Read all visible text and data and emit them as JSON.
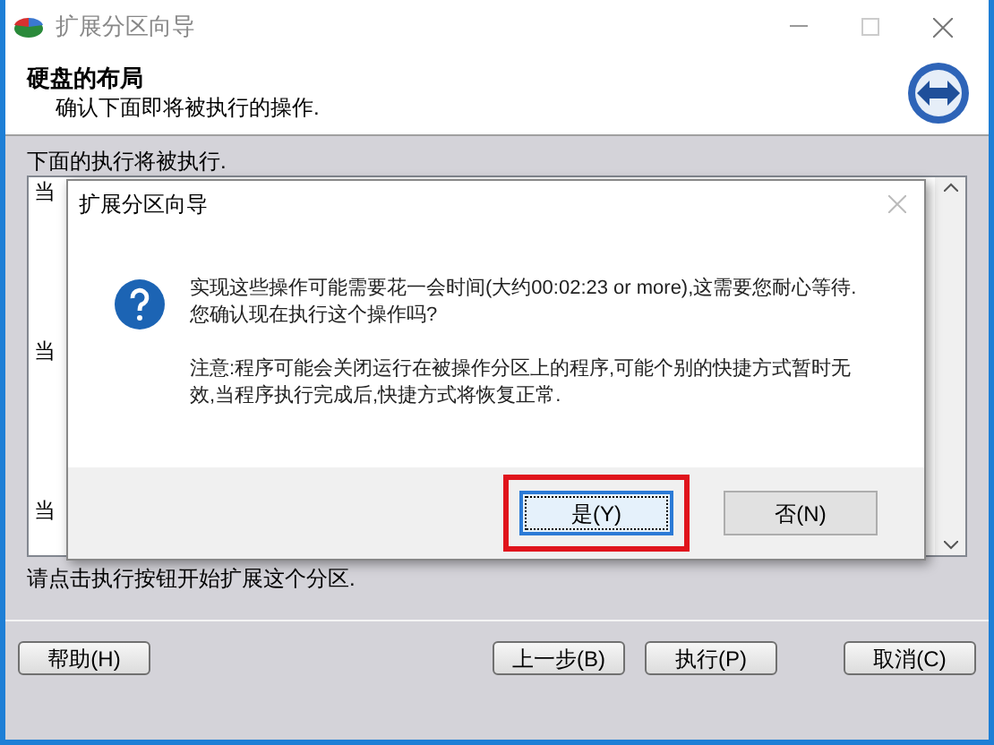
{
  "window": {
    "title": "扩展分区向导"
  },
  "header": {
    "title": "硬盘的布局",
    "subtitle": "确认下面即将被执行的操作."
  },
  "section_label": "下面的执行将被执行.",
  "operations": [
    "当",
    "当",
    "当"
  ],
  "hint": "请点击执行按钮开始扩展这个分区.",
  "buttons": [
    {
      "label": "帮助(H)"
    },
    {
      "label": "上一步(B)"
    },
    {
      "label": "执行(P)"
    },
    {
      "label": "取消(C)"
    }
  ],
  "dialog": {
    "title": "扩展分区向导",
    "message": "实现这些操作可能需要花一会时间(大约00:02:23 or more),这需要您耐心等待.\n您确认现在执行这个操作吗?",
    "note": "注意:程序可能会关闭运行在被操作分区上的程序,可能个别的快捷方式暂时无效,当程序执行完成后,快捷方式将恢复正常.",
    "buttons": [
      {
        "label": "是(Y)",
        "selected": true,
        "highlighted": true
      },
      {
        "label": "否(N)",
        "selected": false,
        "highlighted": false
      }
    ]
  }
}
